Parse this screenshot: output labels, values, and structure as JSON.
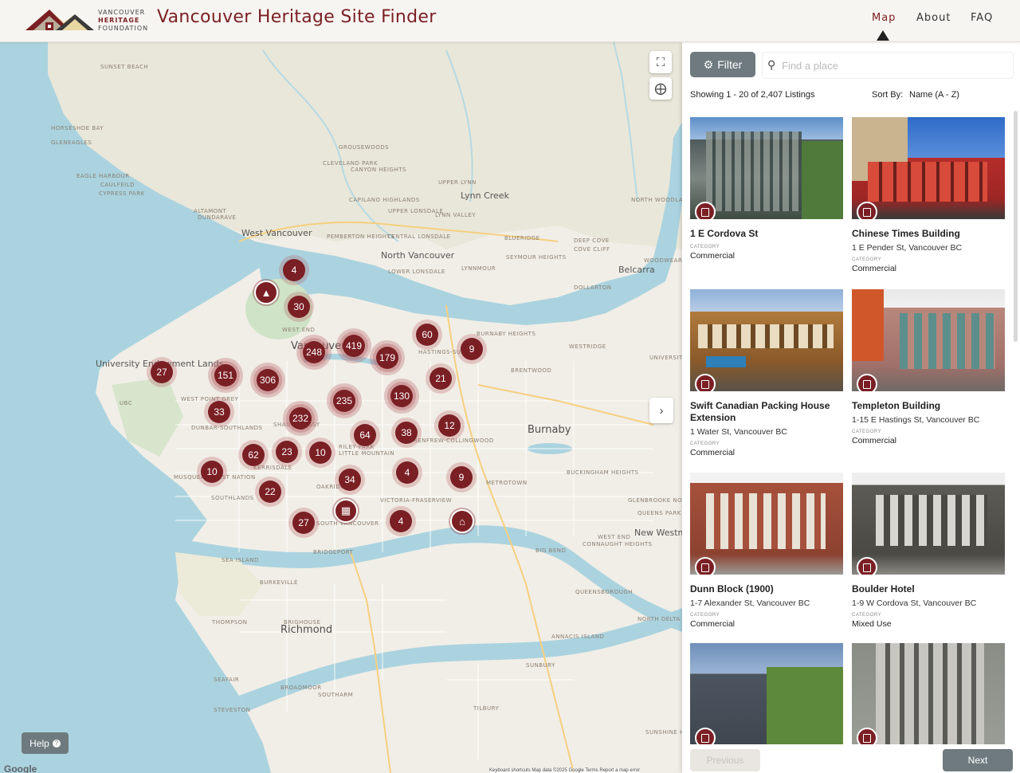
{
  "header": {
    "logo_line1": "VANCOUVER",
    "logo_line2": "HERITAGE",
    "logo_line3": "FOUNDATION",
    "title": "Vancouver Heritage Site Finder",
    "nav": [
      "Map",
      "About",
      "FAQ"
    ],
    "active_nav": "Map"
  },
  "map": {
    "place_labels": [
      "SUNSET BEACH",
      "HORSESHOE BAY",
      "GLENEAGLES",
      "EAGLE HARBOUR",
      "CAULFEILD",
      "CYPRESS PARK",
      "ALTAMONT",
      "DUNDARAVE",
      "GROUSEWOODS",
      "CLEVELAND PARK",
      "CANYON HEIGHTS",
      "UPPER LYNN",
      "CAPILANO HIGHLANDS",
      "UPPER LONSDALE",
      "LYNN VALLEY",
      "PEMBERTON HEIGHTS",
      "CENTRAL LONSDALE",
      "LOWER LONSDALE",
      "LYNNMOUR",
      "BLUERIDGE",
      "DEEP COVE",
      "COVE CLIFF",
      "SEYMOUR HEIGHTS",
      "WOODWEAR",
      "NORTH WOODLANDS",
      "DOLLARTON",
      "WEST END",
      "BURNABY HEIGHTS",
      "HASTINGS-SUN",
      "WESTRIDGE",
      "UNIVERSITY",
      "BRENTWOOD",
      "WEST POINT GREY",
      "UBC",
      "DUNBAR-SOUTHLANDS",
      "SHAUGHNESSY",
      "RENFREW-COLLINGWOOD",
      "RILEY PARK",
      "LITTLE MOUNTAIN",
      "KERRISDALE",
      "MUSQUEAM FIRST NATION",
      "OAKRIDGE",
      "SOUTHLANDS",
      "VICTORIA-FRASERVIEW",
      "METROTOWN",
      "BUCKINGHAM HEIGHTS",
      "GLENBROOKE NORTH",
      "QUEENS PARK",
      "WEST END",
      "CONNAUGHT HEIGHTS",
      "SOUTH VANCOUVER",
      "BRIDGEPORT",
      "SEA ISLAND",
      "BURKEVILLE",
      "BIG BEND",
      "QUEENSBOROUGH",
      "NORTH DELTA",
      "THOMPSON",
      "BRIGHOUSE",
      "ANNACIS ISLAND",
      "SUNBURY",
      "SEAFAIR",
      "BROADMOOR",
      "SOUTHARM",
      "STEVESTON",
      "TILBURY",
      "SUNSHINE HILLS"
    ],
    "city_labels": [
      "West Vancouver",
      "North Vancouver",
      "Lynn Creek",
      "Belcarra",
      "Vancouver",
      "University Endowment Lands",
      "Burnaby",
      "New Westminster",
      "Richmond"
    ],
    "clusters": [
      "4",
      "30",
      "60",
      "9",
      "248",
      "419",
      "179",
      "27",
      "151",
      "306",
      "21",
      "235",
      "130",
      "33",
      "232",
      "12",
      "64",
      "38",
      "62",
      "23",
      "10",
      "10",
      "34",
      "4",
      "9",
      "22",
      "27",
      "4"
    ],
    "fullscreen_icon": "fullscreen-icon",
    "locate_icon": "locate-icon",
    "expand_icon": "chevron-right-icon",
    "help_label": "Help",
    "google_label": "Google",
    "attribution": "Keyboard shortcuts    Map data ©2025 Google    Terms    Report a map error"
  },
  "panel": {
    "filter_label": "Filter",
    "search_placeholder": "Find a place",
    "listing_count": "Showing 1 - 20 of 2,407 Listings",
    "sort_label": "Sort By:",
    "sort_value": "Name (A - Z)",
    "category_label": "CATEGORY",
    "listings": [
      {
        "name": "1 E Cordova St",
        "address": "",
        "category": "Commercial"
      },
      {
        "name": "Chinese Times Building",
        "address": "1 E Pender St, Vancouver BC",
        "category": "Commercial"
      },
      {
        "name": "Swift Canadian Packing House Extension",
        "address": "1 Water St, Vancouver BC",
        "category": "Commercial"
      },
      {
        "name": "Templeton Building",
        "address": "1-15 E Hastings St, Vancouver BC",
        "category": "Commercial"
      },
      {
        "name": "Dunn Block (1900)",
        "address": "1-7 Alexander St, Vancouver BC",
        "category": "Commercial"
      },
      {
        "name": "Boulder Hotel",
        "address": "1-9 W Cordova St, Vancouver BC",
        "category": "Mixed Use"
      },
      {
        "name": "",
        "address": "",
        "category": ""
      },
      {
        "name": "",
        "address": "",
        "category": ""
      }
    ],
    "previous_label": "Previous",
    "next_label": "Next"
  },
  "colors": {
    "accent": "#7a1f24",
    "button_gray": "#6e7a7e",
    "water": "#aad3df",
    "land": "#f1eee7"
  }
}
